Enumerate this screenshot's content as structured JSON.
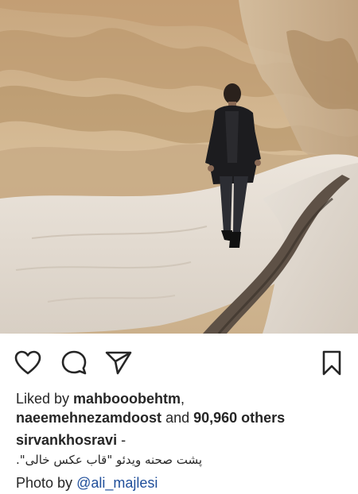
{
  "post": {
    "photo": {
      "subject": "canyon-walker-photo"
    },
    "actions": {
      "like_icon": "heart-outline-icon",
      "comment_icon": "speech-bubble-icon",
      "share_icon": "paper-plane-icon",
      "save_icon": "bookmark-outline-icon"
    },
    "likes": {
      "prefix": "Liked by ",
      "user1": "mahbooobehtm",
      "comma": ",",
      "user2": "naeemehnezamdoost",
      "middle": " and ",
      "count": "90,960 others"
    },
    "caption": {
      "username": "sirvankhosravi",
      "dash": " -",
      "text": "پشت صحنه ویدئو \"قاب عکس خالی\"."
    },
    "credit": {
      "prefix": "Photo by ",
      "mention": "@ali_majlesi"
    }
  },
  "colors": {
    "text": "#262626",
    "mention": "#1f4e9a",
    "background": "#ffffff"
  }
}
